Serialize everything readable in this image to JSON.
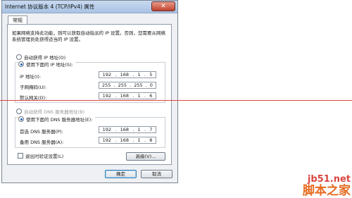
{
  "window": {
    "title": "Internet 协议版本 4 (TCP/IPv4) 属性",
    "close_symbol": "✕"
  },
  "tabs": [
    {
      "label": "常规"
    }
  ],
  "description": "如果网络支持此功能，则可以获取自动指派的 IP 设置。否则，您需要从网络系统管理员处获得适当的 IP 设置。",
  "ip_section": {
    "auto_label": "自动获得 IP 地址(O)",
    "manual_label": "使用下面的 IP 地址(S):",
    "fields": [
      {
        "label": "IP 地址(I):",
        "octets": [
          "192",
          "168",
          "1",
          "5"
        ]
      },
      {
        "label": "子网掩码(U):",
        "octets": [
          "255",
          "255",
          "255",
          "0"
        ]
      },
      {
        "label": "默认网关(D):",
        "octets": [
          "192",
          "168",
          "1",
          "6"
        ]
      }
    ]
  },
  "dns_section": {
    "auto_label": "自动获得 DNS 服务器地址(B)",
    "manual_label": "使用下面的 DNS 服务器地址(E):",
    "fields": [
      {
        "label": "首选 DNS 服务器(P):",
        "octets": [
          "192",
          "168",
          "1",
          "7"
        ]
      },
      {
        "label": "备用 DNS 服务器(A):",
        "octets": [
          "192",
          "168",
          "1",
          "8"
        ]
      }
    ]
  },
  "validate_label": "退出时验证设置(L)",
  "advanced_label": "高级(V)...",
  "ok_label": "确定",
  "cancel_label": "取消",
  "watermark": {
    "url": "jb51.net",
    "name": "脚本之家"
  }
}
